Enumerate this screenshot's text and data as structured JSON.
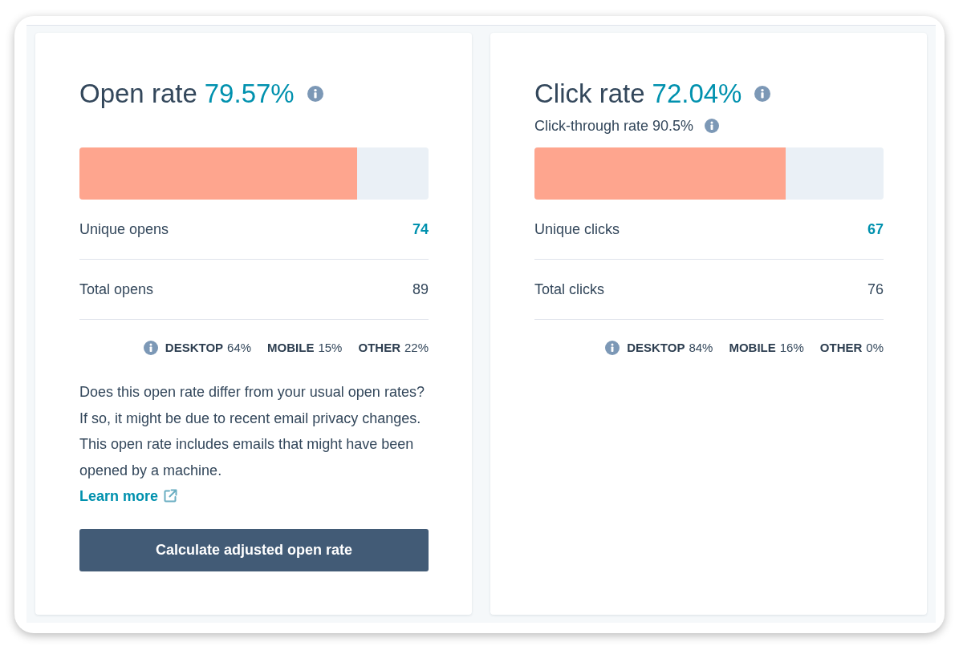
{
  "cards": [
    {
      "title": "Open rate",
      "rate": "79.57%",
      "bar": {
        "level": 0.7957
      },
      "stats": [
        {
          "label": "Unique opens",
          "value": "74",
          "highlighted": true
        },
        {
          "label": "Total opens",
          "value": "89",
          "highlighted": false
        }
      ],
      "devices": [
        {
          "label": "DESKTOP",
          "value": "64%"
        },
        {
          "label": "MOBILE",
          "value": "15%"
        },
        {
          "label": "OTHER",
          "value": "22%"
        }
      ],
      "note": "Does this open rate differ from your usual open rates? If so, it might be due to recent email privacy changes. This open rate includes emails that might have been opened by a machine.",
      "link": "Learn more",
      "button": "Calculate adjusted open rate"
    },
    {
      "title": "Click rate",
      "rate": "72.04%",
      "subtitle": "Click-through rate 90.5%",
      "bar": {
        "level": 0.7204
      },
      "stats": [
        {
          "label": "Unique clicks",
          "value": "67",
          "highlighted": true
        },
        {
          "label": "Total clicks",
          "value": "76",
          "highlighted": false
        }
      ],
      "devices": [
        {
          "label": "DESKTOP",
          "value": "84%"
        },
        {
          "label": "MOBILE",
          "value": "16%"
        },
        {
          "label": "OTHER",
          "value": "0%"
        }
      ]
    }
  ]
}
